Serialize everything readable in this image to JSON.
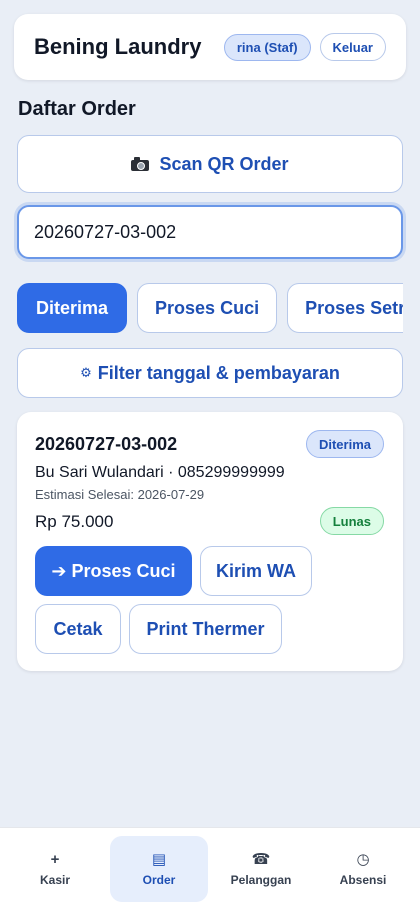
{
  "header": {
    "title": "Bening Laundry",
    "user_badge": "rina (Staf)",
    "logout_label": "Keluar"
  },
  "section_title": "Daftar Order",
  "scan_button": {
    "label": "Scan QR Order",
    "icon": "camera-icon"
  },
  "search": {
    "value": "20260727-03-002"
  },
  "tabs": [
    {
      "label": "Diterima",
      "active": true
    },
    {
      "label": "Proses Cuci",
      "active": false
    },
    {
      "label": "Proses Setrika",
      "active": false
    }
  ],
  "filter_button": {
    "label": "Filter tanggal & pembayaran",
    "icon": "gear-icon"
  },
  "order": {
    "number": "20260727-03-002",
    "status": "Diterima",
    "customer": "Bu Sari Wulandari · 085299999999",
    "estimate": "Estimasi Selesai: 2026-07-29",
    "price": "Rp 75.000",
    "payment_status": "Lunas",
    "actions": {
      "process_label": "➔ Proses Cuci",
      "wa_label": "Kirim WA",
      "print_label": "Cetak",
      "thermal_label": "Print Thermer"
    }
  },
  "bottom_nav": [
    {
      "label": "Kasir",
      "icon": "plus-icon",
      "active": false
    },
    {
      "label": "Order",
      "icon": "list-icon",
      "active": true
    },
    {
      "label": "Pelanggan",
      "icon": "phone-icon",
      "active": false
    },
    {
      "label": "Absensi",
      "icon": "clock-icon",
      "active": false
    }
  ],
  "colors": {
    "accent": "#2f6be6",
    "accent_text": "#1e4fb3",
    "background": "#e9eef6",
    "success_bg": "#dcfce7",
    "success_text": "#15803d"
  }
}
